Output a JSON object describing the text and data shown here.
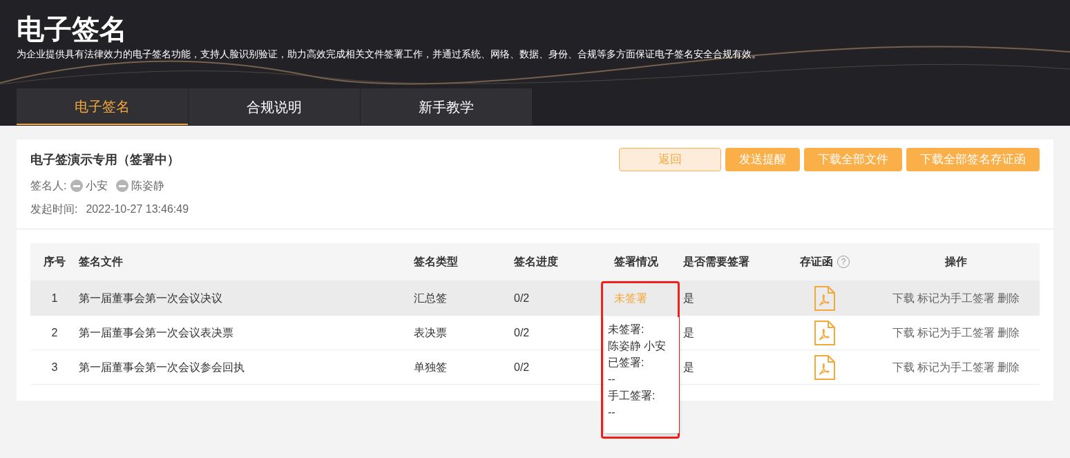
{
  "header": {
    "title": "电子签名",
    "description": "为企业提供具有法律效力的电子签名功能，支持人脸识别验证，助力高效完成相关文件签署工作，并通过系统、网络、数据、身份、合规等多方面保证电子签名安全合规有效。"
  },
  "tabs": [
    {
      "label": "电子签名",
      "selected": true
    },
    {
      "label": "合规说明",
      "selected": false
    },
    {
      "label": "新手教学",
      "selected": false
    }
  ],
  "document": {
    "title": "电子签演示专用（签署中）",
    "signers_label": "签名人:",
    "signers": [
      "小安",
      "陈姿静"
    ],
    "start_label": "发起时间:",
    "start_time": "2022-10-27 13:46:49"
  },
  "buttons": [
    {
      "label": "返回",
      "kind": "secondary"
    },
    {
      "label": "发送提醒",
      "kind": "primary"
    },
    {
      "label": "下载全部文件",
      "kind": "primary"
    },
    {
      "label": "下载全部签名存证函",
      "kind": "primary"
    }
  ],
  "table": {
    "help_icon": "?",
    "columns": [
      "序号",
      "签名文件",
      "签名类型",
      "签名进度",
      "签署情况",
      "是否需要签署",
      "存证函",
      "操作"
    ],
    "rows": [
      {
        "index": "1",
        "file": "第一届董事会第一次会议决议",
        "type": "汇总签",
        "progress": "0/2",
        "status": "未签署",
        "required": "是",
        "actions": [
          "下载",
          "标记为手工签署",
          "删除"
        ],
        "highlighted": true
      },
      {
        "index": "2",
        "file": "第一届董事会第一次会议表决票",
        "type": "表决票",
        "progress": "0/2",
        "required": "是",
        "actions": [
          "下载",
          "标记为手工签署",
          "删除"
        ],
        "highlighted": false
      },
      {
        "index": "3",
        "file": "第一届董事会第一次会议参会回执",
        "type": "单独签",
        "progress": "0/2",
        "required": "是",
        "actions": [
          "下载",
          "标记为手工签署",
          "删除"
        ],
        "highlighted": false
      }
    ]
  },
  "tooltip": {
    "lines": [
      "未签署:",
      "陈姿静 小安",
      "已签署:",
      "--",
      "手工签署:",
      "--"
    ]
  }
}
